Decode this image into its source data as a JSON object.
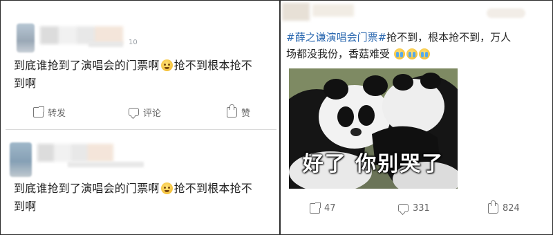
{
  "posts": [
    {
      "meta_fragment": "10",
      "text_line1": "到底谁抢到了演唱会的门票啊",
      "text_line1b": "抢不到根本抢不",
      "text_line2": "到啊",
      "emoji_icon": "grin-emoji-icon",
      "actions": {
        "repost": "转发",
        "comment": "评论",
        "like": "赞"
      }
    },
    {
      "text_line1": "到底谁抢到了演唱会的门票啊",
      "text_line1b": "抢不到根本抢不",
      "text_line2": "到啊",
      "emoji_icon": "grin-emoji-icon"
    }
  ],
  "right_post": {
    "hashtag": "#薛之谦演唱会门票#",
    "text_after_hashtag": "抢不到，根本抢不到，万人",
    "text_line2": "场都没我份，香菇难受",
    "cry_emoji_icon": "crying-emoji-icon",
    "image_caption": "好了 你别哭了",
    "counts": {
      "repost": "47",
      "comment": "331",
      "like": "824"
    }
  },
  "colors": {
    "hashtag": "#2b68b0",
    "text": "#222222",
    "action": "#666666"
  }
}
